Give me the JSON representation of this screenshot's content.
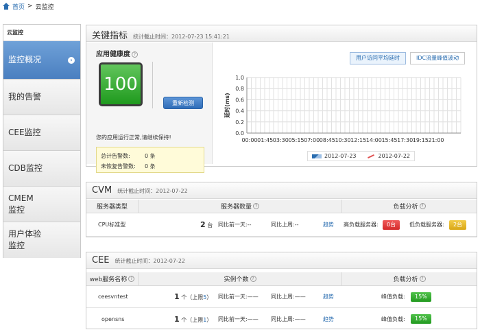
{
  "breadcrumb": {
    "home": "首页",
    "sep": ">",
    "current": "云监控"
  },
  "sidebar": {
    "title": "云监控",
    "items": [
      {
        "label": "监控概况"
      },
      {
        "label": "我的告警"
      },
      {
        "label": "CEE监控"
      },
      {
        "label": "CDB监控"
      },
      {
        "label": "CMEM\n监控"
      },
      {
        "label": "用户体验\n监控"
      }
    ]
  },
  "key_metrics": {
    "title": "关键指标",
    "updated": "统计截止时间：2012-07-23 15:41:21",
    "health_label": "应用健康度",
    "score": "100",
    "recheck": "重新检测",
    "message": "您的应用运行正常,请继续保持!",
    "alerts": [
      {
        "label": "总计告警数:",
        "value": "0 条"
      },
      {
        "label": "未恢复告警数:",
        "value": "0 条"
      }
    ],
    "tabs": [
      "用户访问平均延时",
      "IDC流量峰值波动"
    ]
  },
  "chart_data": {
    "type": "line",
    "ylabel": "延时(ms)",
    "ylim": [
      0,
      1.0
    ],
    "yticks": [
      "0.0",
      "0.2",
      "0.4",
      "0.6",
      "0.8",
      "1.0"
    ],
    "x": [
      "00:00",
      "01:45",
      "03:30",
      "05:15",
      "07:00",
      "08:45",
      "10:30",
      "12:15",
      "14:00",
      "15:45",
      "17:30",
      "19:15",
      "21:00"
    ],
    "series": [
      {
        "name": "2012-07-23",
        "values": []
      },
      {
        "name": "2012-07-22",
        "values": []
      }
    ],
    "legend": "bottom",
    "grid": true
  },
  "cvm": {
    "title": "CVM",
    "updated": "统计截止时间：2012-07-22",
    "headers": [
      "服务器类型",
      "服务器数量",
      "负载分析"
    ],
    "rows": [
      {
        "type": "CPU标准型",
        "count": "2",
        "unit": "台",
        "day": "同比前一天:--",
        "week": "同比上周:--",
        "trend": "趋势",
        "high_label": "高负载服务器:",
        "high": "0台",
        "low_label": "低负载服务器:",
        "low": "2台"
      }
    ]
  },
  "cee": {
    "title": "CEE",
    "updated": "统计截止时间：2012-07-22",
    "headers": [
      "web服务名称",
      "实例个数",
      "负载分析"
    ],
    "rows": [
      {
        "name": "ceesvntest",
        "count": "1",
        "unit": "个（上限",
        "limit": "5",
        "close": "）",
        "day": "同比前一天:——",
        "week": "同比上周:——",
        "trend": "趋势",
        "peak_label": "峰值负载:",
        "peak": "15%"
      },
      {
        "name": "opensns",
        "count": "1",
        "unit": "个（上限",
        "limit": "1",
        "close": "）",
        "day": "同比前一天:——",
        "week": "同比上周:——",
        "trend": "趋势",
        "peak_label": "峰值负载:",
        "peak": "15%"
      }
    ]
  }
}
